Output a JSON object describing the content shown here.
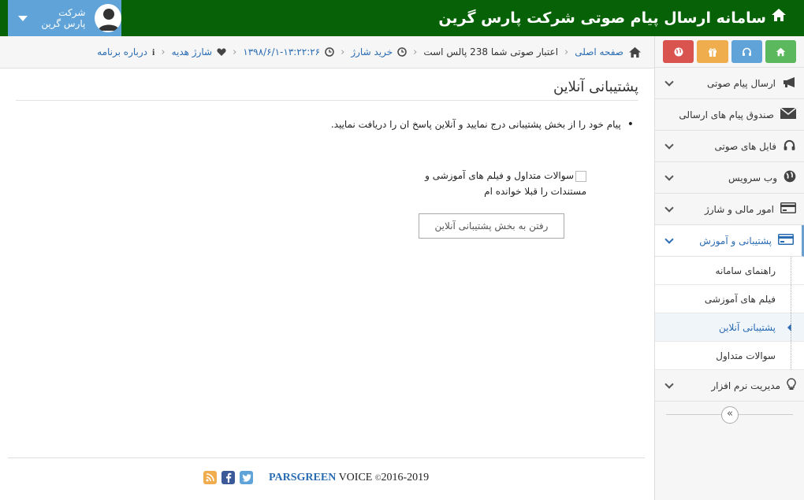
{
  "header": {
    "title": "سامانه ارسال پیام صوتی شرکت پارس گرین",
    "user_line1": "شرکت",
    "user_line2": "پارس گرین"
  },
  "breadcrumb": {
    "home": "صفحه اصلی",
    "credit": "اعتبار صوتی شما 238 پالس است",
    "buy": "خرید شارژ",
    "datetime": "۱۳۹۸/۶/۱-۱۳:۲۲:۲۶",
    "gift": "شارژ هدیه",
    "about": "درباره برنامه"
  },
  "shortcuts": [
    {
      "icon": "home-icon",
      "color": "#5cb85c"
    },
    {
      "icon": "headphones-icon",
      "color": "#5fa3d8"
    },
    {
      "icon": "gift-icon",
      "color": "#f0ad4e"
    },
    {
      "icon": "globe-icon",
      "color": "#d9534f"
    }
  ],
  "sidebar": {
    "items": [
      {
        "label": "ارسال پیام صوتی",
        "icon": "megaphone-icon"
      },
      {
        "label": "صندوق پیام های ارسالی",
        "icon": "envelope-icon"
      },
      {
        "label": "فایل های صوتی",
        "icon": "headphones-icon"
      },
      {
        "label": "وب سرویس",
        "icon": "globe-icon"
      },
      {
        "label": "امور مالی و شارژ",
        "icon": "credit-card-icon"
      },
      {
        "label": "پشتیبانی و آموزش",
        "icon": "credit-card-icon"
      },
      {
        "label": "مدیریت نرم افزار",
        "icon": "lightbulb-icon"
      }
    ],
    "sub_items": [
      {
        "label": "راهنمای سامانه"
      },
      {
        "label": "فیلم های آموزشی"
      },
      {
        "label": "پشتیبانی آنلاین"
      },
      {
        "label": "سوالات متداول"
      }
    ],
    "collapse_glyph": "«"
  },
  "main": {
    "title": "پشتیبانی آنلاین",
    "notice": "پیام خود را از بخش پشتیبانی درج نمایید و آنلاین پاسخ ان را دریافت نمایید.",
    "checkbox_label": "سوالات متداول و فیلم های آموزشی و مستندات را قبلا خوانده ام",
    "button": "رفتن به بخش پشتیبانی آنلاین"
  },
  "footer": {
    "years": "2016-2019",
    "copyright": "©",
    "brand": "PARSGREEN",
    "product": "VOICE"
  },
  "colors": {
    "header_bg": "#076207",
    "user_bg": "#5fa3d8",
    "link": "#2a6cb3"
  }
}
